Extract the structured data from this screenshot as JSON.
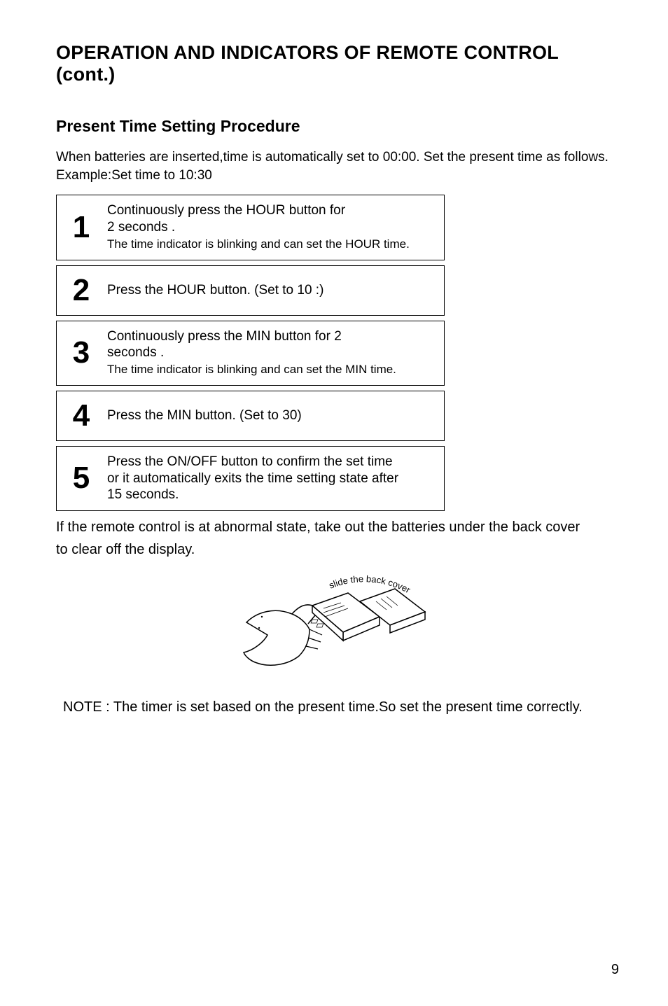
{
  "title": "OPERATION AND INDICATORS OF REMOTE CONTROL (cont.)",
  "subtitle": "Present Time Setting Procedure",
  "intro": {
    "line1": "When batteries are inserted,time is automatically set to 00:00. Set the present time as follows.",
    "line2": "Example:Set time to 10:30"
  },
  "steps": [
    {
      "num": "1",
      "main1": "Continuously press the HOUR button for",
      "main2": "2 seconds .",
      "sub": "The time indicator is blinking and can set the HOUR time."
    },
    {
      "num": "2",
      "main1": "Press the HOUR button.   (Set to 10 :)"
    },
    {
      "num": "3",
      "main1": "Continuously press the MIN button for 2",
      "main2": "seconds .",
      "sub": "The time indicator is blinking and can set the MIN time."
    },
    {
      "num": "4",
      "main1": "Press the MIN button.   (Set to 30)"
    },
    {
      "num": "5",
      "main1": "Press the ON/OFF button to confirm the set time",
      "main2": "or it automatically exits the time setting state after",
      "main3": "15 seconds."
    }
  ],
  "afterSteps": {
    "line1": "If the remote control is at abnormal state, take out the batteries under the back cover",
    "line2": "to clear off the display."
  },
  "diagram": {
    "curvedText": "slide the back cover"
  },
  "note": "NOTE : The timer is set based on the present time.So set the present time correctly.",
  "pageNumber": "9"
}
